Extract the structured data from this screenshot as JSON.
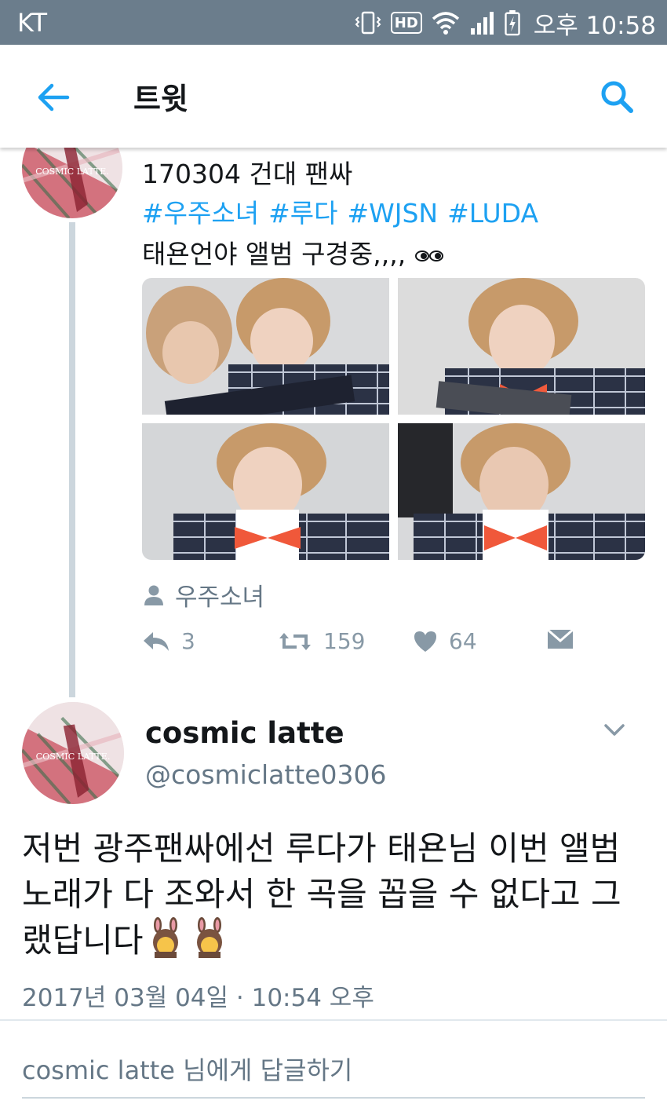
{
  "status_bar": {
    "carrier": "KT",
    "icons": [
      "vibrate-icon",
      "hd-icon",
      "wifi-icon",
      "signal-icon",
      "battery-icon"
    ],
    "hd_label": "HD",
    "time": "오후 10:58"
  },
  "app_bar": {
    "title": "트윗",
    "back_icon": "back-arrow-icon",
    "search_icon": "search-icon"
  },
  "parent_tweet": {
    "avatar_text": "COSMIC LATTE.",
    "line1": "170304 건대 팬싸",
    "hashtags": [
      "#우주소녀",
      "#루다",
      "#WJSN",
      "#LUDA"
    ],
    "line3": "태욘언야 앨범 구경중,,,,",
    "place": "우주소녀",
    "actions": {
      "reply_count": "3",
      "retweet_count": "159",
      "like_count": "64"
    }
  },
  "main_tweet": {
    "avatar_text": "COSMIC LATTE.",
    "name": "cosmic latte",
    "handle": "@cosmiclatte0306",
    "text": "저번 광주팬싸에선 루다가 태욘님 이번 앨범 노래가 다 조와서 한 곡을 꼽을 수 없다고 그랬답니다",
    "timestamp": "2017년 03월 04일 · 10:54 오후"
  },
  "reply_box": {
    "placeholder": "cosmic latte 님에게 답글하기"
  },
  "colors": {
    "status_bar": "#6b7d8c",
    "link": "#1da1f2",
    "secondary_text": "#657786",
    "icon_gray": "#8899a6"
  }
}
